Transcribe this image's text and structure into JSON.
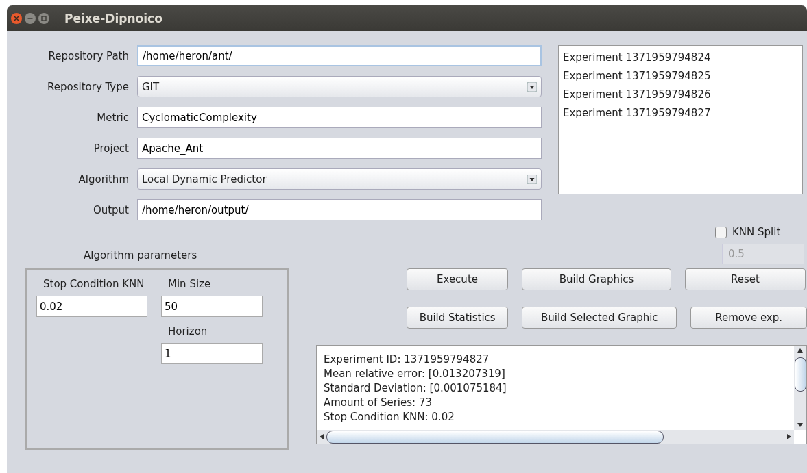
{
  "window": {
    "title": "Peixe-Dipnoico"
  },
  "form": [
    {
      "label": "Repository Path",
      "kind": "text",
      "value": "/home/heron/ant/",
      "focused": true
    },
    {
      "label": "Repository Type",
      "kind": "combo",
      "value": "GIT",
      "focused": false
    },
    {
      "label": "Metric",
      "kind": "text",
      "value": "CyclomaticComplexity",
      "focused": false
    },
    {
      "label": "Project",
      "kind": "text",
      "value": "Apache_Ant",
      "focused": false
    },
    {
      "label": "Algorithm",
      "kind": "combo",
      "value": "Local Dynamic Predictor",
      "focused": false
    },
    {
      "label": "Output",
      "kind": "text",
      "value": "/home/heron/output/",
      "focused": false
    }
  ],
  "experiments": [
    {
      "label": "Experiment 1371959794824",
      "selected": false
    },
    {
      "label": "Experiment 1371959794825",
      "selected": false
    },
    {
      "label": "Experiment 1371959794826",
      "selected": false
    },
    {
      "label": "Experiment 1371959794827",
      "selected": false
    }
  ],
  "knn_split": {
    "label": "KNN Split",
    "checked": false,
    "value": "0.5",
    "disabled": true
  },
  "parameters": {
    "title": "Algorithm parameters",
    "stop_condition": {
      "label": "Stop Condition KNN",
      "value": "0.02"
    },
    "min_size": {
      "label": "Min Size",
      "value": "50"
    },
    "horizon": {
      "label": "Horizon",
      "value": "1"
    }
  },
  "buttons": [
    [
      "Execute",
      "Build Graphics",
      "Reset"
    ],
    [
      "Build Statistics",
      "Build Selected Graphic",
      "Remove exp."
    ]
  ],
  "output_lines": [
    "Experiment ID: 1371959794827",
    "Mean relative error: [0.013207319]",
    "Standard Deviation: [0.001075184]",
    "Amount of Series: 73",
    "Stop Condition KNN: 0.02"
  ]
}
